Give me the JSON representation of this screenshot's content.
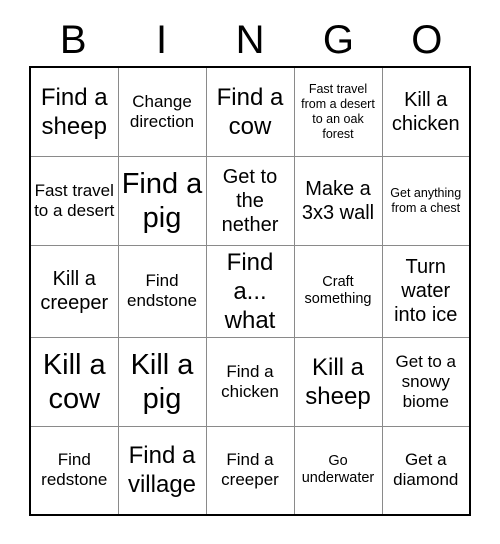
{
  "card": {
    "header": {
      "letters": [
        "B",
        "I",
        "N",
        "G",
        "O"
      ]
    },
    "rows": [
      [
        {
          "text": "Find a sheep",
          "size": "fs-xl"
        },
        {
          "text": "Change direction",
          "size": "fs-md"
        },
        {
          "text": "Find a cow",
          "size": "fs-xl"
        },
        {
          "text": "Fast travel from a desert to an oak forest",
          "size": "fs-xs"
        },
        {
          "text": "Kill a chicken",
          "size": "fs-lg"
        }
      ],
      [
        {
          "text": "Fast travel to a desert",
          "size": "fs-md"
        },
        {
          "text": "Find a pig",
          "size": "fs-xxl"
        },
        {
          "text": "Get to the nether",
          "size": "fs-lg"
        },
        {
          "text": "Make a 3x3 wall",
          "size": "fs-lg"
        },
        {
          "text": "Get anything from a chest",
          "size": "fs-xs"
        }
      ],
      [
        {
          "text": "Kill a creeper",
          "size": "fs-lg"
        },
        {
          "text": "Find endstone",
          "size": "fs-md"
        },
        {
          "text": "Find a... what",
          "size": "fs-xl"
        },
        {
          "text": "Craft something",
          "size": "fs-sm"
        },
        {
          "text": "Turn water into ice",
          "size": "fs-lg"
        }
      ],
      [
        {
          "text": "Kill a cow",
          "size": "fs-xxl"
        },
        {
          "text": "Kill a pig",
          "size": "fs-xxl"
        },
        {
          "text": "Find a chicken",
          "size": "fs-md"
        },
        {
          "text": "Kill a sheep",
          "size": "fs-xl"
        },
        {
          "text": "Get to a snowy biome",
          "size": "fs-md"
        }
      ],
      [
        {
          "text": "Find redstone",
          "size": "fs-md"
        },
        {
          "text": "Find a village",
          "size": "fs-xl"
        },
        {
          "text": "Find a creeper",
          "size": "fs-md"
        },
        {
          "text": "Go underwater",
          "size": "fs-sm"
        },
        {
          "text": "Get a diamond",
          "size": "fs-md"
        }
      ]
    ]
  }
}
